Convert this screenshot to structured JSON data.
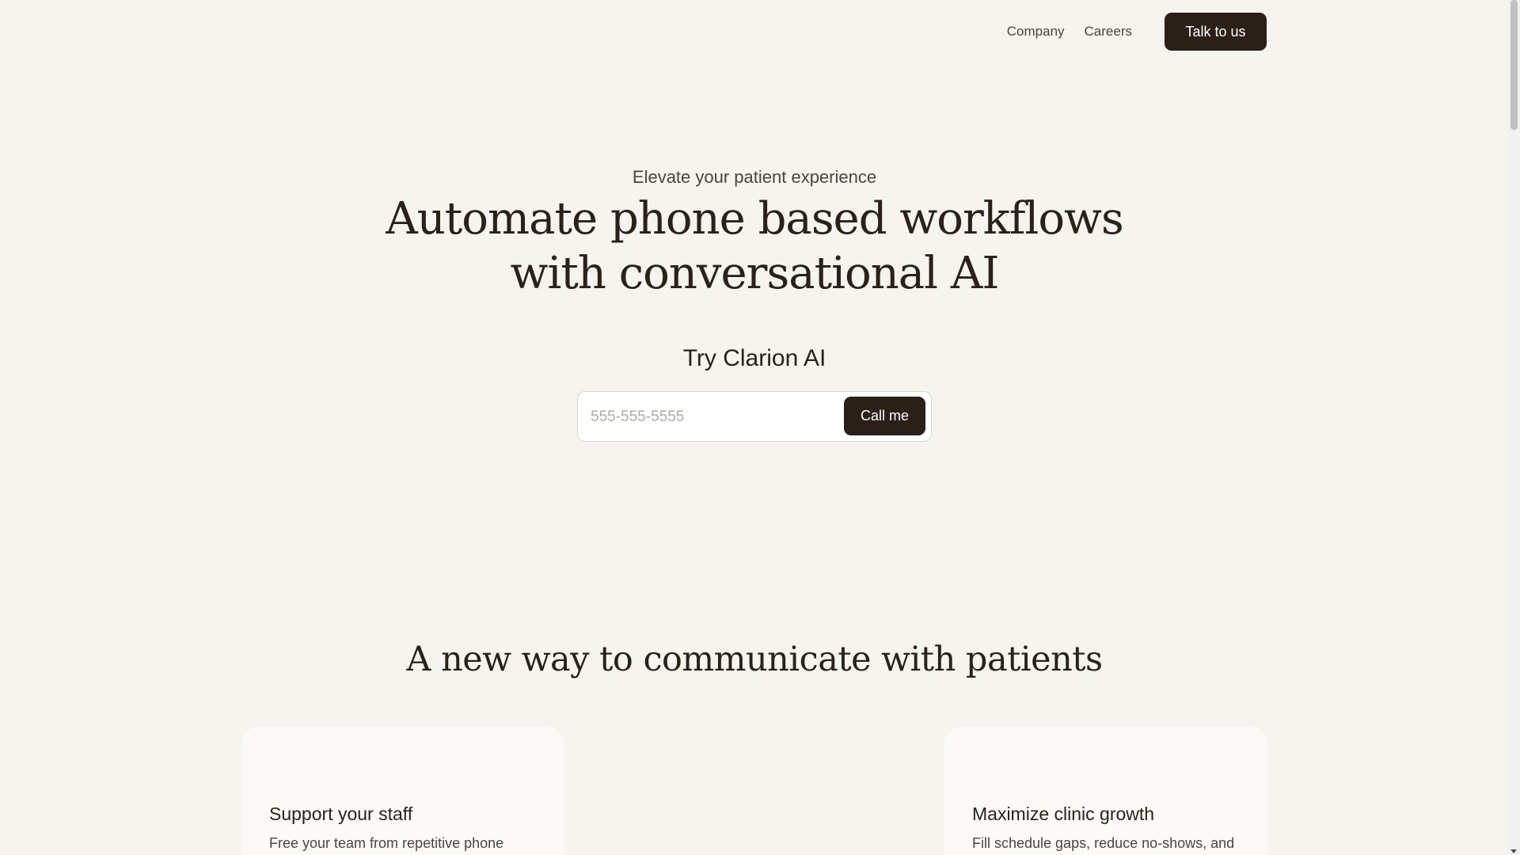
{
  "nav": {
    "links": [
      {
        "label": "Company"
      },
      {
        "label": "Careers"
      }
    ],
    "cta_label": "Talk to us"
  },
  "hero": {
    "eyebrow": "Elevate your patient experience",
    "headline": "Automate phone based workflows with conversational AI",
    "try_label": "Try Clarion AI",
    "phone_placeholder": "555-555-5555",
    "phone_value": "",
    "call_button_label": "Call me"
  },
  "section": {
    "title": "A new way to communicate with patients",
    "cards": [
      {
        "title": "Support your staff",
        "text": "Free your team from repetitive phone"
      },
      {
        "title": "Maximize clinic growth",
        "text": "Fill schedule gaps, reduce no-shows, and"
      }
    ]
  },
  "colors": {
    "background": "#f5f4ee",
    "primary_button": "#2b2018",
    "text_dark": "#2a2119",
    "card_background": "#fbfaf7"
  }
}
